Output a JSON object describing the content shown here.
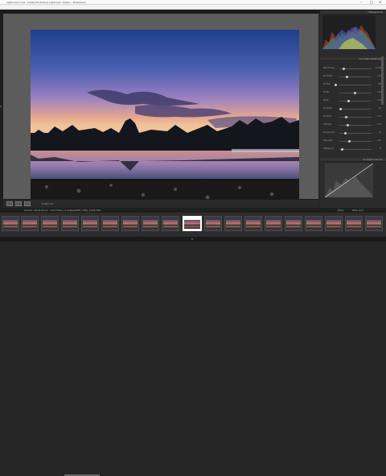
{
  "window": {
    "title": "Lightroom.lrcat - Adobe Photoshop Lightroom Classic - Entwickeln",
    "controls": [
      "–",
      "□",
      "✕"
    ]
  },
  "menu": [
    "Datei",
    "Bearbeiten",
    "Entwickeln",
    "Foto",
    "Einstellungen",
    "Werkzeuge",
    "Ansicht",
    "Fenster",
    "Hilfe"
  ],
  "right_panel": {
    "histogram_label": "Histogramm",
    "basic_label": "Grundeinstellungen",
    "basic_rows": [
      {
        "label": "Belichtung",
        "value": "+0,35"
      },
      {
        "label": "Kontrast",
        "value": "+12"
      },
      {
        "label": "Lichter",
        "value": "-68"
      },
      {
        "label": "Tiefen",
        "value": "+54"
      },
      {
        "label": "Weiß",
        "value": "+18"
      },
      {
        "label": "Schwarz",
        "value": "-22"
      },
      {
        "label": "Struktur",
        "value": "+10"
      },
      {
        "label": "Klarheit",
        "value": "+15"
      },
      {
        "label": "Dunst entf.",
        "value": "+8"
      },
      {
        "label": "Dynamik",
        "value": "+20"
      },
      {
        "label": "Sättigung",
        "value": "0"
      }
    ],
    "tone_curve_label": "Gradationskurve",
    "prev_button": "Vorherige",
    "reset_button": "Zurücksetzen"
  },
  "toolbar": {
    "softproof_label": "Softproof"
  },
  "filmstrip_bar": {
    "info": "Ordner: 2019-04-11 · 140 Fotos / 1 ausgewählt / IMG_7139.CR2",
    "filter_label": "Filter:",
    "filter_value": "Filter aus"
  }
}
